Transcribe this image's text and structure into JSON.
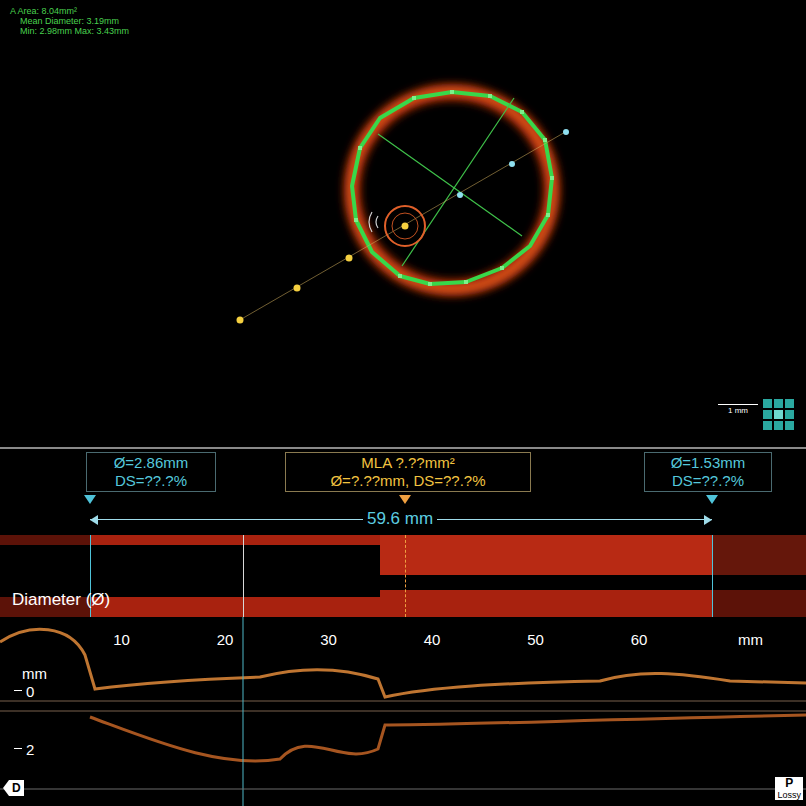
{
  "cross_section": {
    "area": "A Area: 8.04mm²",
    "mean_diameter": "Mean Diameter: 3.19mm",
    "min_max": "Min: 2.98mm  Max: 3.43mm",
    "scale": "1 mm"
  },
  "markers": [
    {
      "kind": "reference",
      "line1": "Ø=2.86mm",
      "line2": "DS=??.?%"
    },
    {
      "kind": "mla",
      "line1": "MLA ?.??mm²",
      "line2": "Ø=?.??mm, DS=??.?%"
    },
    {
      "kind": "reference",
      "line1": "Ø=1.53mm",
      "line2": "DS=??.?%"
    }
  ],
  "length": "59.6 mm",
  "diameter_label": "Diameter (Ø)",
  "axis": {
    "ticks": [
      "10",
      "20",
      "30",
      "40",
      "50",
      "60"
    ],
    "unit": "mm"
  },
  "depth_axis": {
    "unit": "mm",
    "ticks": [
      "0",
      "2"
    ]
  },
  "ends": {
    "distal": "D",
    "proximal": "P",
    "compression": "Lossy"
  }
}
